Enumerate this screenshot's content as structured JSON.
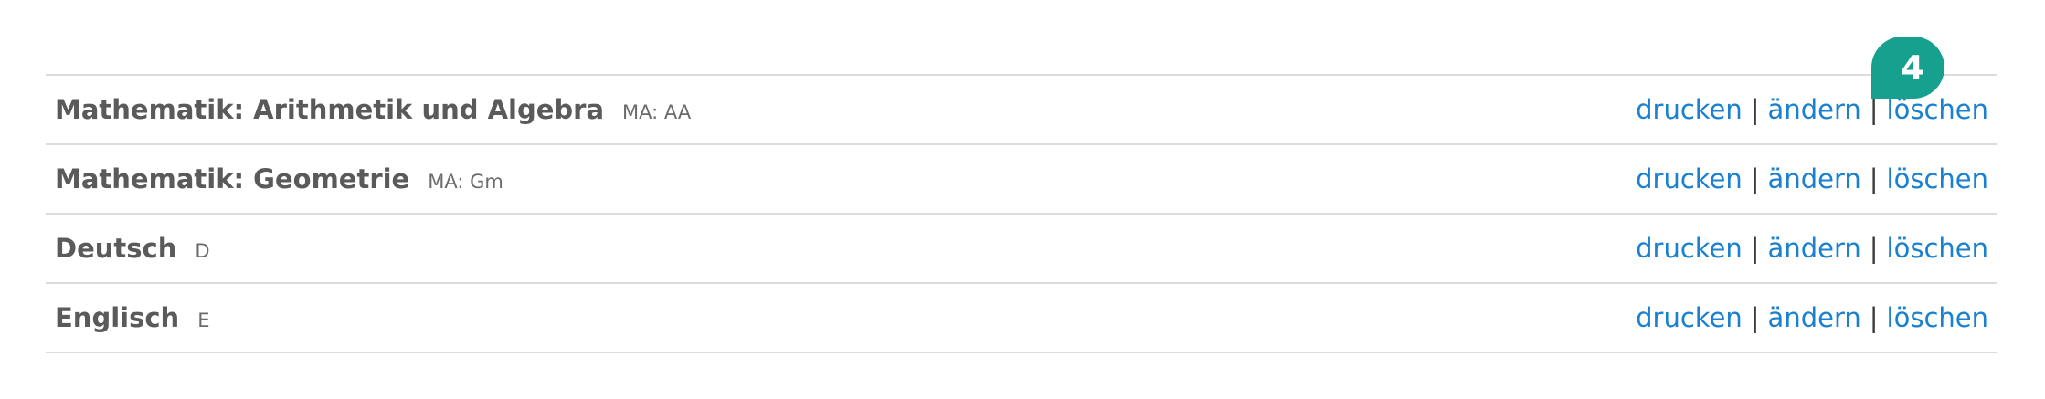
{
  "subjects": [
    {
      "name": "Mathematik: Arithmetik und Algebra",
      "abbr": "MA: AA"
    },
    {
      "name": "Mathematik: Geometrie",
      "abbr": "MA: Gm"
    },
    {
      "name": "Deutsch",
      "abbr": "D"
    },
    {
      "name": "Englisch",
      "abbr": "E"
    }
  ],
  "actions": {
    "print_label": "drucken",
    "edit_label": "ändern",
    "delete_label": "löschen",
    "separator": "|"
  },
  "tour_badge": {
    "number": "4",
    "color": "#16a08e"
  },
  "colors": {
    "link": "#1a80d0",
    "subject_text": "#5a5a5a",
    "divider": "#dcdcdc"
  }
}
